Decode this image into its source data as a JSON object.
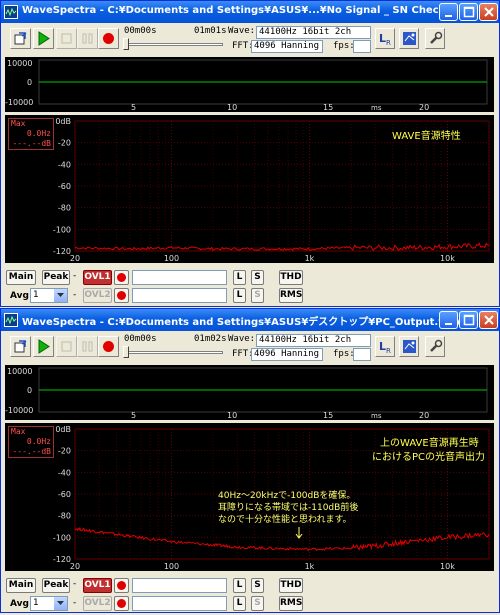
{
  "windows": [
    {
      "title": "WaveSpectra - C:¥Documents and Settings¥ASUS¥...¥No Signal _ SN Check.wav",
      "time_start": "00m00s",
      "time_end": "01m01s",
      "wave_label": "Wave:",
      "wave_value": "44100Hz 16bit 2ch",
      "fft_label": "FFT:",
      "fft_value": "4096 Hanning",
      "fps_label": "fps:",
      "scope_y_top": "10000",
      "scope_y_mid": "0",
      "scope_y_bot": "-10000",
      "scope_x_ticks": [
        "5",
        "10",
        "15",
        "20"
      ],
      "scope_x_unit": "ms",
      "max_label": "Max",
      "max_hz": "0.0Hz",
      "max_db": "---.--dB",
      "annotation": "WAVE音源特性",
      "annotation_small": []
    },
    {
      "title": "WaveSpectra - C:¥Documents and Settings¥ASUS¥デスクトップ¥PC_Output.wav",
      "time_start": "00m00s",
      "time_end": "01m02s",
      "wave_label": "Wave:",
      "wave_value": "44100Hz 16bit 2ch",
      "fft_label": "FFT:",
      "fft_value": "4096 Hanning",
      "fps_label": "fps:",
      "scope_y_top": "10000",
      "scope_y_mid": "0",
      "scope_y_bot": "-10000",
      "scope_x_ticks": [
        "5",
        "10",
        "15",
        "20"
      ],
      "scope_x_unit": "ms",
      "max_label": "Max",
      "max_hz": "0.0Hz",
      "max_db": "---.--dB",
      "annotation": "上のWAVE音源再生時",
      "annotation2": "におけるPCの光音声出力",
      "annotation_small": [
        "40Hz～20kHzで-100dBを確保。",
        "耳障りになる帯域では-110dB前後",
        "なので十分な性能と思われます。"
      ]
    }
  ],
  "spectrum_axis": {
    "y_ticks": [
      "0dB",
      "-20",
      "-40",
      "-60",
      "-80",
      "-100",
      "-120"
    ],
    "x_ticks": [
      "20",
      "100",
      "1k",
      "10k"
    ]
  },
  "controls": {
    "main": "Main",
    "peak": "Peak",
    "ovl1": "OVL1",
    "ovl2": "OVL2",
    "avg_label": "Avg:",
    "avg_value": "1",
    "dash": "-",
    "l": "L",
    "s": "S",
    "thd": "THD",
    "rms": "RMS"
  },
  "colors": {
    "titlebar": "#0553d8",
    "scope_trace": "#00c800",
    "spectrum_trace": "#e00000",
    "grid": "#5a0000",
    "annotation": "#ffff50"
  },
  "chart_data": [
    {
      "type": "line",
      "title": "",
      "xlabel": "",
      "ylabel": "",
      "x_scale": "log",
      "xlim": [
        20,
        20000
      ],
      "ylim": [
        -120,
        0
      ],
      "series": [
        {
          "x": [
            20,
            50,
            100,
            200,
            500,
            1000,
            2000,
            5000,
            10000,
            20000
          ],
          "y": [
            -117,
            -118,
            -117,
            -118,
            -118,
            -118,
            -117,
            -117,
            -116,
            -115
          ]
        }
      ]
    },
    {
      "type": "line",
      "title": "",
      "xlabel": "",
      "ylabel": "",
      "x_scale": "log",
      "xlim": [
        20,
        20000
      ],
      "ylim": [
        -120,
        0
      ],
      "series": [
        {
          "x": [
            20,
            30,
            50,
            100,
            200,
            300,
            500,
            1000,
            2000,
            3000,
            5000,
            10000,
            20000
          ],
          "y": [
            -92,
            -95,
            -99,
            -104,
            -107,
            -109,
            -110,
            -111,
            -110,
            -108,
            -104,
            -100,
            -97
          ]
        }
      ]
    }
  ]
}
